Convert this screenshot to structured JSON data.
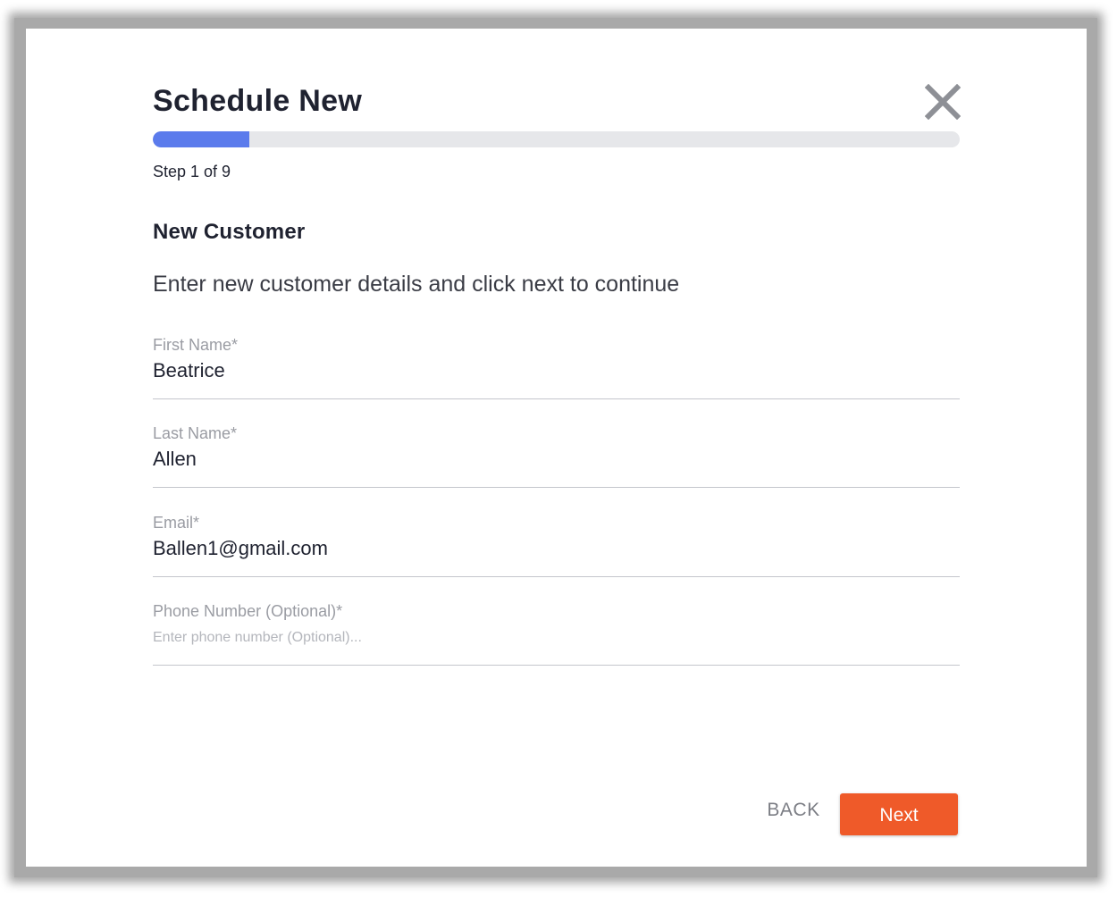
{
  "modal": {
    "title": "Schedule New",
    "close_icon": "close-x-icon"
  },
  "progress": {
    "current_step": 1,
    "total_steps": 9,
    "fraction": 0.12,
    "step_text": "Step 1 of 9"
  },
  "section": {
    "title": "New Customer",
    "instructions": "Enter new customer details and click next to continue"
  },
  "fields": {
    "first_name": {
      "label": "First Name*",
      "value": "Beatrice"
    },
    "last_name": {
      "label": "Last Name*",
      "value": "Allen"
    },
    "email": {
      "label": "Email*",
      "value": "Ballen1@gmail.com"
    },
    "phone": {
      "label": "Phone Number (Optional)*",
      "value": "",
      "placeholder": "Enter phone number (Optional)..."
    }
  },
  "actions": {
    "back_label": "BACK",
    "next_label": "Next"
  },
  "colors": {
    "accent": "#5b7bec",
    "primary_button": "#ef5a29",
    "track": "#e6e7ea"
  }
}
